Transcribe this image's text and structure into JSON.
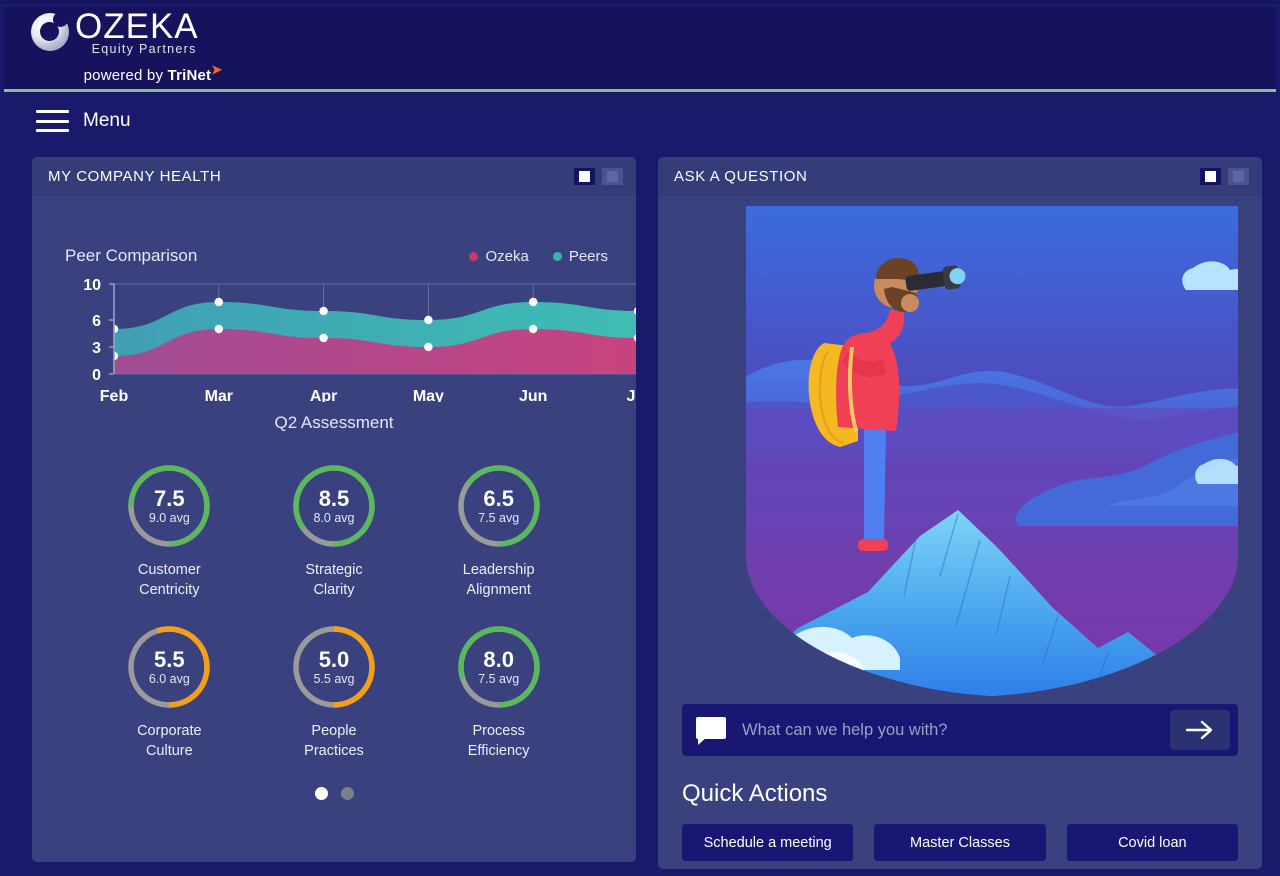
{
  "brand": {
    "name": "OZEKA",
    "tagline": "Equity Partners",
    "powered_prefix": "powered by ",
    "powered_brand": "TriNet",
    "accent_orange": "#f26722",
    "rule_green": "#7fc194"
  },
  "nav": {
    "menu_label": "Menu"
  },
  "left_panel": {
    "title": "MY COMPANY HEALTH",
    "assessment_title": "Q2 Assessment",
    "gauges": [
      {
        "value": "7.5",
        "avg": "9.0 avg",
        "label_1": "Customer",
        "label_2": "Centricity",
        "pct": 75,
        "color": "#5cb85c"
      },
      {
        "value": "8.5",
        "avg": "8.0 avg",
        "label_1": "Strategic",
        "label_2": "Clarity",
        "pct": 85,
        "color": "#5cb85c"
      },
      {
        "value": "6.5",
        "avg": "7.5 avg",
        "label_1": "Leadership",
        "label_2": "Alignment",
        "pct": 65,
        "color": "#5cb85c"
      },
      {
        "value": "5.5",
        "avg": "6.0 avg",
        "label_1": "Corporate",
        "label_2": "Culture",
        "pct": 55,
        "color": "#f0a019"
      },
      {
        "value": "5.0",
        "avg": "5.5 avg",
        "label_1": "People",
        "label_2": "Practices",
        "pct": 50,
        "color": "#f0a019"
      },
      {
        "value": "8.0",
        "avg": "7.5 avg",
        "label_1": "Process",
        "label_2": "Efficiency",
        "pct": 80,
        "color": "#5cb85c"
      }
    ],
    "pagination": {
      "total": 2,
      "active_index": 0
    }
  },
  "right_panel": {
    "title": "ASK A QUESTION",
    "search": {
      "value": "",
      "placeholder": "What can we help you with?"
    },
    "quick_actions_title": "Quick Actions",
    "quick_actions": [
      "Schedule a meeting",
      "Master Classes",
      "Covid loan"
    ]
  },
  "chart_data": {
    "type": "area",
    "title": "Peer Comparison",
    "categories": [
      "Feb",
      "Mar",
      "Apr",
      "May",
      "Jun",
      "Jul"
    ],
    "series": [
      {
        "name": "Ozeka",
        "color": "#d6336c",
        "values": [
          2.0,
          5.0,
          4.0,
          3.0,
          5.0,
          4.0
        ]
      },
      {
        "name": "Peers",
        "color": "#3bb3a8",
        "values": [
          5.0,
          8.0,
          7.0,
          6.0,
          8.0,
          7.0
        ]
      }
    ],
    "xlabel": "",
    "ylabel": "",
    "ylim": [
      0,
      10
    ],
    "yticks": [
      0,
      3,
      6,
      10
    ],
    "grid": true,
    "legend_position": "top-right",
    "stacked": false
  }
}
